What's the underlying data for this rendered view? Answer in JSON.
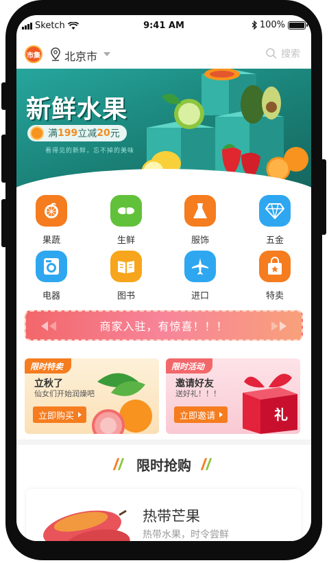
{
  "status_bar": {
    "carrier": "Sketch",
    "time": "9:41 AM",
    "battery": "100%"
  },
  "header": {
    "logo_text": "市集",
    "city": "北京市",
    "search_placeholder": "搜索"
  },
  "banner": {
    "title": "新鲜水果",
    "promo_prefix": "满",
    "promo_amount1": "199",
    "promo_mid": "立减",
    "promo_amount2": "20",
    "promo_suffix": "元",
    "subtitle": "看得见的新鲜，忘不掉的美味"
  },
  "categories": [
    {
      "label": "果蔬",
      "icon": "orange-fruit-icon",
      "color": "#f57c1f"
    },
    {
      "label": "生鲜",
      "icon": "peanut-icon",
      "color": "#62c13a"
    },
    {
      "label": "服饰",
      "icon": "dress-icon",
      "color": "#f57c1f"
    },
    {
      "label": "五金",
      "icon": "diamond-icon",
      "color": "#2ea7f0"
    },
    {
      "label": "电器",
      "icon": "washing-machine-icon",
      "color": "#2ea7f0"
    },
    {
      "label": "图书",
      "icon": "book-icon",
      "color": "#f7a51c"
    },
    {
      "label": "进口",
      "icon": "airplane-icon",
      "color": "#2ea7f0"
    },
    {
      "label": "特卖",
      "icon": "shopping-bag-icon",
      "color": "#f57c1f"
    }
  ],
  "merchant_bar": {
    "text": "商家入驻，有惊喜！！！"
  },
  "cards": [
    {
      "tag": "限时特卖",
      "title": "立秋了",
      "subtitle": "仙女们开始润燥吧",
      "action": "立即购买"
    },
    {
      "tag": "限时活动",
      "title": "邀请好友",
      "subtitle": "送好礼！！！",
      "action": "立即邀请",
      "gift_char": "礼"
    }
  ],
  "flash_sale": {
    "title": "限时抢购"
  },
  "product": {
    "name": "热带芒果",
    "desc": "热带水果，时令尝鲜"
  },
  "colors": {
    "accent_orange": "#f57c1f",
    "banner_teal": "#1a8177",
    "merchant_pink": "#f2676a"
  }
}
